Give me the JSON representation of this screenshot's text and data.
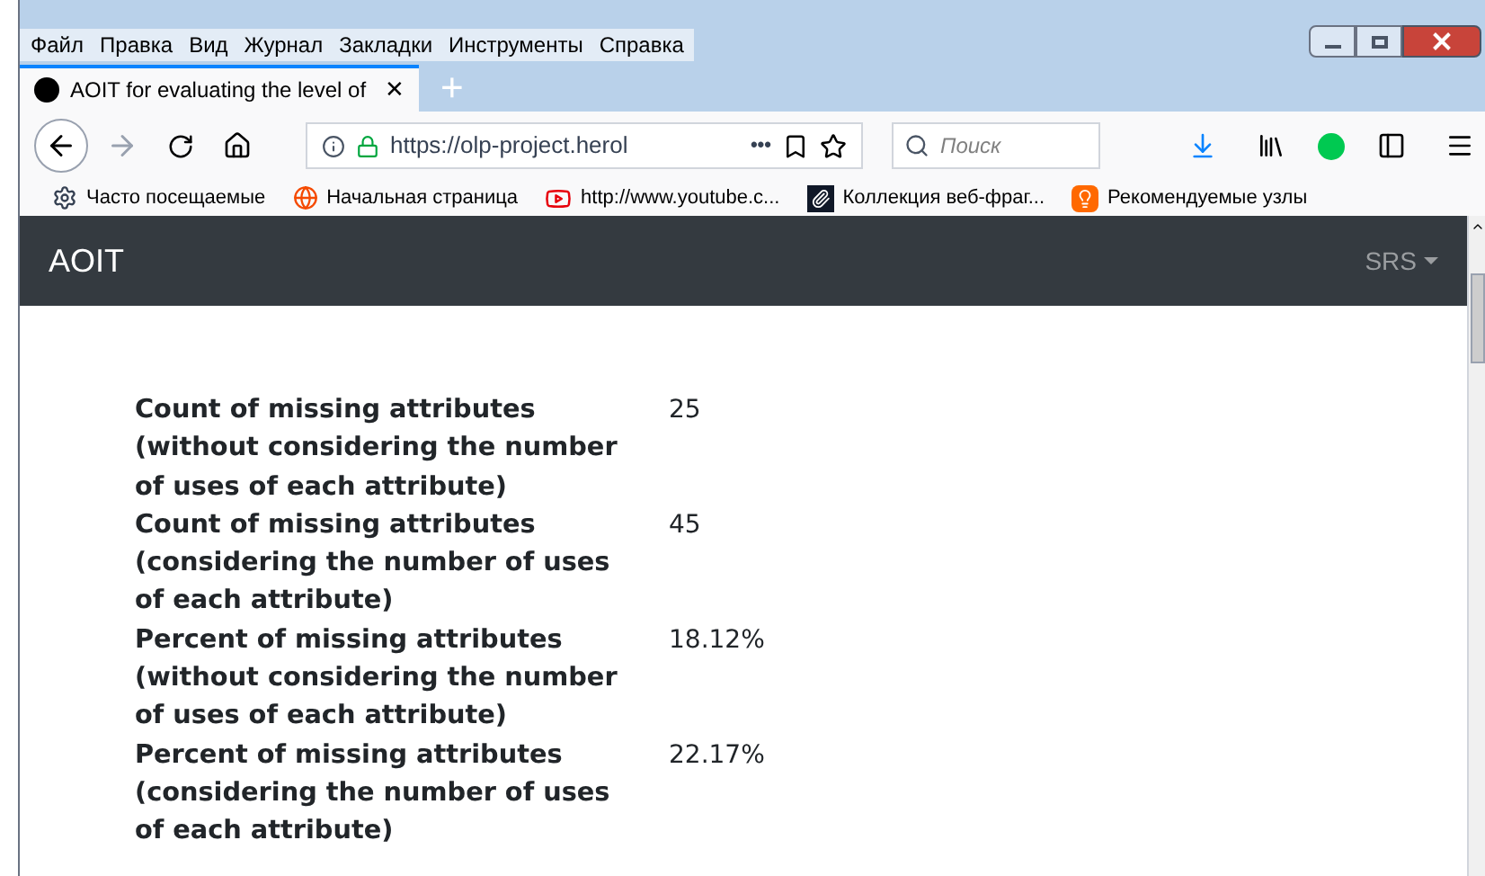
{
  "menu_bar": [
    "Файл",
    "Правка",
    "Вид",
    "Журнал",
    "Закладки",
    "Инструменты",
    "Справка"
  ],
  "tabs": [
    {
      "title": "AOIT for evaluating the level of",
      "selected": true,
      "close": "✕"
    }
  ],
  "new_tab": "+",
  "address_bar": {
    "url": "https://olp-project.herol",
    "more": "•••"
  },
  "search": {
    "placeholder": "Поиск"
  },
  "bookmarks": [
    {
      "kind": "gear",
      "label": "Часто посещаемые"
    },
    {
      "kind": "firefox",
      "label": "Начальная страница"
    },
    {
      "kind": "youtube",
      "label": "http://www.youtube.c..."
    },
    {
      "kind": "clip",
      "label": "Коллекция веб-фраг..."
    },
    {
      "kind": "bulb",
      "label": "Рекомендуемые узлы"
    }
  ],
  "navbar": {
    "brand": "AOIT",
    "menu": "SRS"
  },
  "stats": [
    {
      "label": "Count of missing attributes (without considering the number of uses of each attribute)",
      "value": "25"
    },
    {
      "label": "Count of missing attributes (considering the number of uses of each attribute)",
      "value": "45"
    },
    {
      "label": "Percent of missing attributes (without considering the number of uses of each attribute)",
      "value": "18.12%"
    },
    {
      "label": "Percent of missing attributes (considering the number of uses of each attribute)",
      "value": "22.17%"
    }
  ]
}
